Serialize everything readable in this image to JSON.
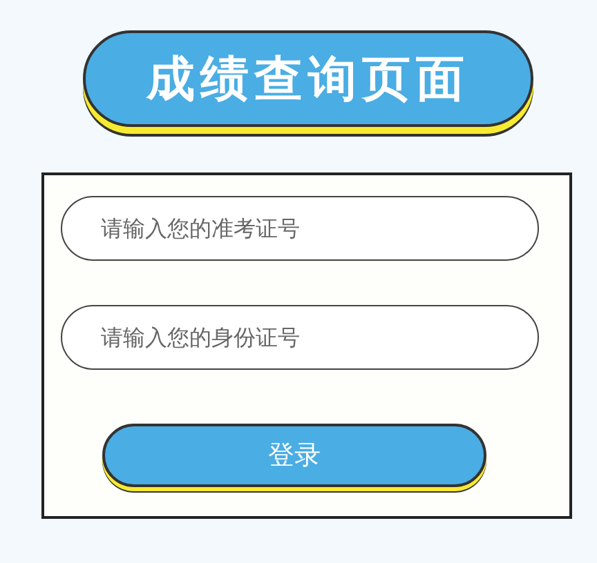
{
  "title": "成绩查询页面",
  "fields": [
    {
      "placeholder": "请输入您的准考证号"
    },
    {
      "placeholder": "请输入您的身份证号"
    }
  ],
  "button": "登录"
}
